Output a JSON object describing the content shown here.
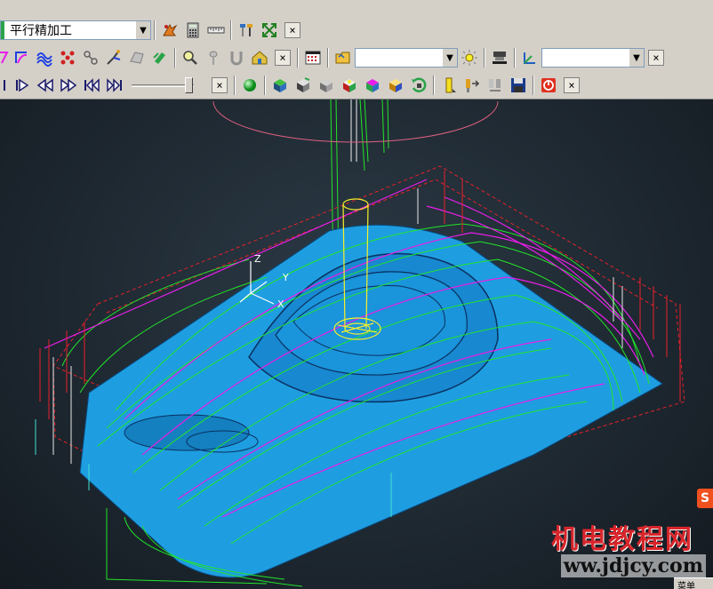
{
  "toolbar": {
    "strategy_value": "平行精加工",
    "row1_icons": [
      "toolpath-verify-icon",
      "calculator-icon",
      "ruler-icon",
      "tool-holder-icon",
      "fit-view-icon"
    ],
    "row2_icons": [
      "toolpath-select-icon",
      "curve-pattern-icon",
      "wave-pattern-icon",
      "points-icon",
      "link-icon",
      "leads-icon",
      "boundary-icon",
      "stock-model-icon",
      "layers-icon"
    ],
    "row2_icons_b": [
      "search-zoom-icon",
      "probe-icon",
      "magnet-icon",
      "house-icon"
    ],
    "row2_icons_c": [
      "calendar-grid-icon"
    ],
    "row2_icons_d": [
      "open-folder-icon"
    ],
    "row2_combo1_value": "",
    "row2_icons_e": [
      "light-icon"
    ],
    "row2_icons_f": [
      "machine-icon"
    ],
    "row2_icons_g": [
      "workplane-icon"
    ],
    "row2_combo2_value": "",
    "row3_playback_icons": [
      "step-forward-icon",
      "play-icon",
      "fast-rewind-icon",
      "fast-forward-icon",
      "skip-start-icon",
      "skip-end-icon"
    ],
    "row3_slider_value": 0.9,
    "row3_shading_icons": [
      "green-sphere-icon"
    ],
    "row3_shade_icons": [
      "shaded-block-icon",
      "flip-block-icon",
      "grey-block-icon",
      "multi-color-block-icon",
      "color-block-icon",
      "gold-block-icon",
      "rotate-view-icon"
    ],
    "row3_tool_icons": [
      "yellow-tool-icon",
      "tool-move-icon",
      "tool-swap-icon",
      "save-disk-icon"
    ],
    "row3_stop_icon": "stop-icon",
    "close_glyph": "×"
  },
  "axes": {
    "x_label": "X",
    "y_label": "Y",
    "z_label": "Z"
  },
  "watermark": {
    "text_cn": "机电教程网",
    "url": "ww.jdjcy.com",
    "badge_letter": "S",
    "corner_tag": "菜单"
  },
  "colors": {
    "toolbar_bg": "#d4d0c8",
    "viewport_bg": "#1f2a33",
    "surface": "#1e9ee0",
    "toolpath_green": "#22e52a",
    "toolpath_magenta": "#e81ee8",
    "rapid_red": "#e8202a",
    "tool_yellow": "#f5f02a",
    "link_cyan": "#40e0d0"
  }
}
